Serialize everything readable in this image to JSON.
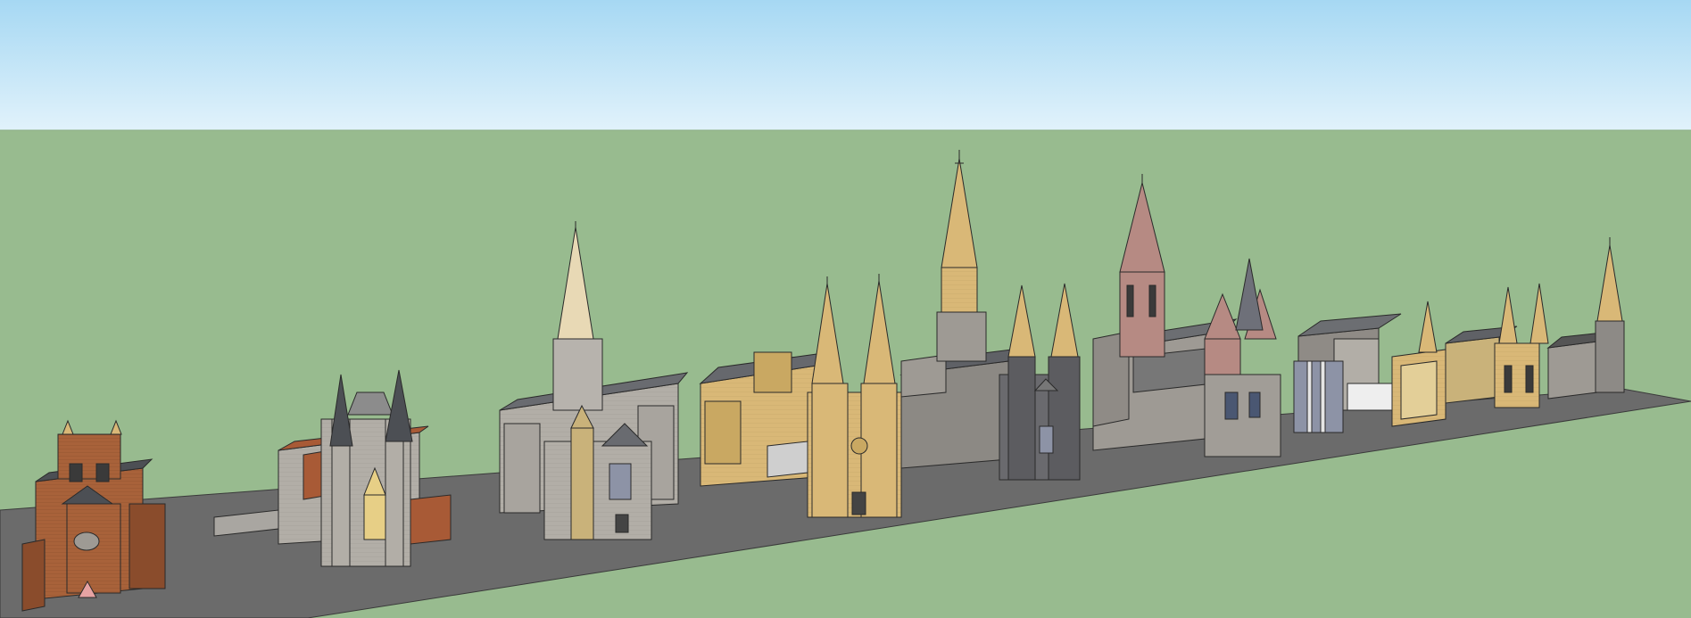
{
  "scene": {
    "kind": "3d-model-viewport",
    "colors": {
      "sky_top": "#a6d8f3",
      "sky_bottom": "#e1f2fb",
      "ground": "#98bb8f",
      "road": "#6b6b6b",
      "outline": "#2a2a2a",
      "brick": "#a8623a",
      "stone_grey": "#b2aea7",
      "stone_light": "#c9c4bb",
      "sandstone": "#d9b877",
      "slate": "#4c4f54",
      "copper_roof": "#a85a36",
      "pink_stone": "#b68a83",
      "glass": "#8d93a6"
    },
    "models": [
      {
        "name": "brick-cathedral",
        "style": "brick twin-tower facade with rose window"
      },
      {
        "name": "twin-spire-cathedral",
        "style": "grey stone with dark slate spires"
      },
      {
        "name": "central-spire-cathedral",
        "style": "grey stone with tall pale central spire"
      },
      {
        "name": "sandstone-twin-spire-cathedral",
        "style": "sandstone with twin spires"
      },
      {
        "name": "tallest-spire-cathedral",
        "style": "sandstone crossing spire, grey nave"
      },
      {
        "name": "pink-spire-cathedral",
        "style": "pink stone tower and spires"
      },
      {
        "name": "distant-cathedral-group",
        "style": "mixed sandstone and grey, small spires"
      }
    ]
  }
}
